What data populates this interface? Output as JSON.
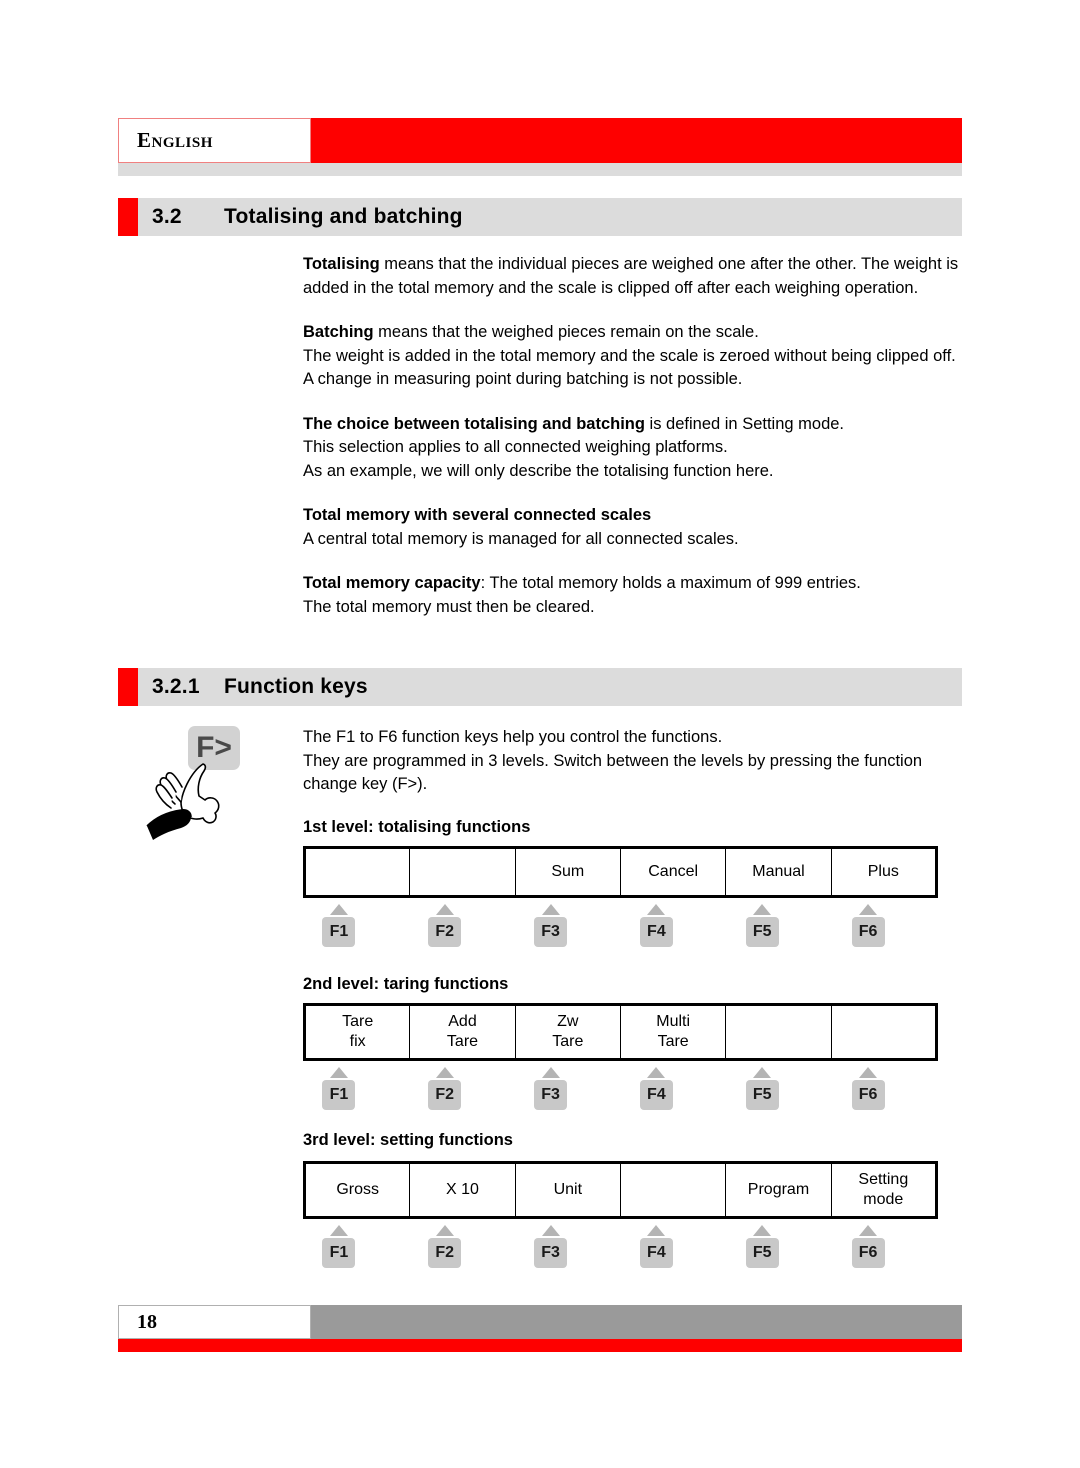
{
  "header": {
    "language": "English",
    "accent_color": "#fe0000",
    "strip_color": "#dcdcdc"
  },
  "sections": {
    "s32": {
      "number": "3.2",
      "title": "Totalising and batching"
    },
    "s321": {
      "number": "3.2.1",
      "title": "Function keys"
    }
  },
  "body": {
    "p1_lead": "Totalising",
    "p1_rest": " means that the individual pieces are weighed one after the other. The weight is added in the total memory and the scale is clipped off after each weighing operation.",
    "p2_lead": "Batching",
    "p2_rest": " means that the weighed pieces remain on the scale.",
    "p2_line2": "The weight is added in the total memory and the scale is zeroed without being clipped off.",
    "p2_line3": "A change in measuring point during batching is not possible.",
    "p3_lead": "The choice between totalising and batching",
    "p3_rest": " is defined in Setting mode.",
    "p3_line2": "This selection applies to all connected weighing platforms.",
    "p3_line3": "As an example, we will only describe the totalising function here.",
    "p4_heading": "Total memory with several connected scales",
    "p4_line": "A central total memory is managed for all connected scales.",
    "p5_lead": "Total memory capacity",
    "p5_rest": ": The total memory holds a maximum of 999 entries.",
    "p5_line2": "The total memory must then be cleared."
  },
  "function_keys_intro": {
    "line1": "The F1 to F6 function keys help you control the functions.",
    "line2": "They are programmed in 3 levels. Switch between the levels by pressing the function change key (F>).",
    "key_icon_label": "F>"
  },
  "levels": [
    {
      "label": "1st level: totalising functions",
      "cells": [
        {
          "line1": "",
          "line2": ""
        },
        {
          "line1": "",
          "line2": ""
        },
        {
          "line1": "Sum",
          "line2": ""
        },
        {
          "line1": "Cancel",
          "line2": ""
        },
        {
          "line1": "Manual",
          "line2": ""
        },
        {
          "line1": "Plus",
          "line2": ""
        }
      ],
      "keys": [
        "F1",
        "F2",
        "F3",
        "F4",
        "F5",
        "F6"
      ]
    },
    {
      "label": "2nd level: taring functions",
      "cells": [
        {
          "line1": "Tare",
          "line2": "fix"
        },
        {
          "line1": "Add",
          "line2": "Tare"
        },
        {
          "line1": "Zw",
          "line2": "Tare"
        },
        {
          "line1": "Multi",
          "line2": "Tare"
        },
        {
          "line1": "",
          "line2": ""
        },
        {
          "line1": "",
          "line2": ""
        }
      ],
      "keys": [
        "F1",
        "F2",
        "F3",
        "F4",
        "F5",
        "F6"
      ]
    },
    {
      "label": "3rd level: setting functions",
      "cells": [
        {
          "line1": "Gross",
          "line2": ""
        },
        {
          "line1": "X 10",
          "line2": ""
        },
        {
          "line1": "Unit",
          "line2": ""
        },
        {
          "line1": "",
          "line2": ""
        },
        {
          "line1": "Program",
          "line2": ""
        },
        {
          "line1": "Setting",
          "line2": "mode"
        }
      ],
      "keys": [
        "F1",
        "F2",
        "F3",
        "F4",
        "F5",
        "F6"
      ]
    }
  ],
  "footer": {
    "page_number": "18",
    "bar_color": "#9a9a9a",
    "accent_color": "#fe0000"
  }
}
